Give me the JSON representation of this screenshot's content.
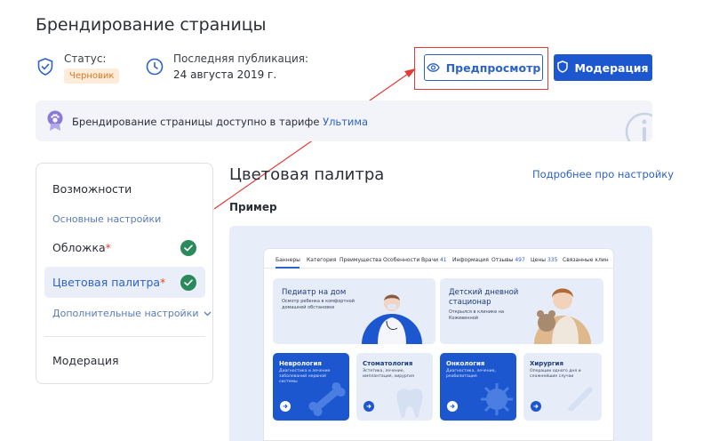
{
  "page": {
    "title": "Брендирование страницы"
  },
  "status": {
    "label": "Статус:",
    "value": "Черновик"
  },
  "publication": {
    "label": "Последняя публикация:",
    "value": "24 августа 2019 г."
  },
  "actions": {
    "preview_label": "Предпросмотр",
    "moderation_label": "Модерация"
  },
  "info": {
    "text": "Брендирование страницы доступно в тарифе",
    "link": "Ультима"
  },
  "sidebar": {
    "items": [
      {
        "label": "Возможности"
      },
      {
        "label": "Основные настройки"
      },
      {
        "label": "Обложка",
        "required": "*"
      },
      {
        "label": "Цветовая палитра",
        "required": "*"
      },
      {
        "label": "Дополнительные настройки"
      },
      {
        "label": "Модерация"
      }
    ]
  },
  "main": {
    "title": "Цветовая палитра",
    "more_link": "Подробнее про настройку",
    "example_label": "Пример"
  },
  "mock": {
    "tabs": [
      {
        "label": "Баннеры"
      },
      {
        "label": "Категория"
      },
      {
        "label": "Преимущества"
      },
      {
        "label": "Особенности"
      },
      {
        "label": "Врачи",
        "count": "41"
      },
      {
        "label": "Информация"
      },
      {
        "label": "Отзывы",
        "count": "497"
      },
      {
        "label": "Цены",
        "count": "335"
      },
      {
        "label": "Связанные клин"
      }
    ],
    "banners": [
      {
        "title": "Педиатр на дом",
        "sub": "Осмотр ребенка в комфортной домашней обстановке"
      },
      {
        "title": "Детский дневной стационар",
        "sub": "Открылся в клинике на Кожевенной"
      }
    ],
    "services": [
      {
        "title": "Неврология",
        "sub": "Диагностика и лечение заболеваний нервной системы"
      },
      {
        "title": "Стоматология",
        "sub": "Эстетика, лечение, имплантация, хирургия"
      },
      {
        "title": "Онкология",
        "sub": "Диагностика, лечение, реабилитация"
      },
      {
        "title": "Хирургия",
        "sub": "Операции одного дня и сложнейшие случаи"
      }
    ]
  },
  "colors": {
    "accent": "#1c57d0",
    "link": "#2d63c8",
    "success": "#2a8a5c",
    "draft_badge_bg": "#fdecd9",
    "highlight": "#e53935"
  }
}
